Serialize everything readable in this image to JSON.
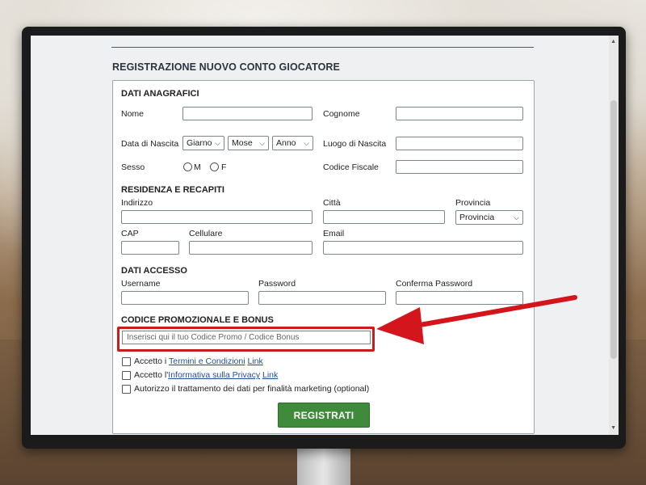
{
  "page_title": "REGISTRAZIONE NUOVO CONTO GIOCATORE",
  "sections": {
    "anagrafici": "DATI ANAGRAFICI",
    "residenza": "RESIDENZA E RECAPITI",
    "accesso": "DATI ACCESSO",
    "promo": "CODICE PROMOZIONALE E BONUS"
  },
  "fields": {
    "nome": "Nome",
    "cognome": "Cognome",
    "data_nascita": "Data di Nascita",
    "luogo_nascita": "Luogo di Nascita",
    "sesso": "Sesso",
    "codice_fiscale": "Codice Fiscale",
    "indirizzo": "Indirizzo",
    "citta": "Città",
    "provincia": "Provincia",
    "cap": "CAP",
    "cellulare": "Cellulare",
    "email": "Email",
    "username": "Username",
    "password": "Password",
    "conferma_password": "Conferma Password"
  },
  "selects": {
    "giorno": "Giarno",
    "mese": "Mose",
    "anno": "Anno",
    "provincia": "Provincia"
  },
  "radios": {
    "m": "M",
    "f": "F"
  },
  "promo": {
    "placeholder": "Inserisci qui il tuo Codice Promo / Codice Bonus"
  },
  "checks": {
    "termini_prefix": "Accetto i ",
    "termini_link": "Termini e Condizioni",
    "termini_link2": "Link",
    "privacy_prefix": "Accetto l'",
    "privacy_link": "Informativa sulla Privacy",
    "privacy_link2": "Link",
    "marketing": "Autorizzo il trattamento dei dati per finalità marketing (optional)"
  },
  "submit_label": "REGISTRATI",
  "colors": {
    "highlight": "#cc1b1b",
    "button": "#3f8a3b",
    "link": "#1f4f9a"
  }
}
